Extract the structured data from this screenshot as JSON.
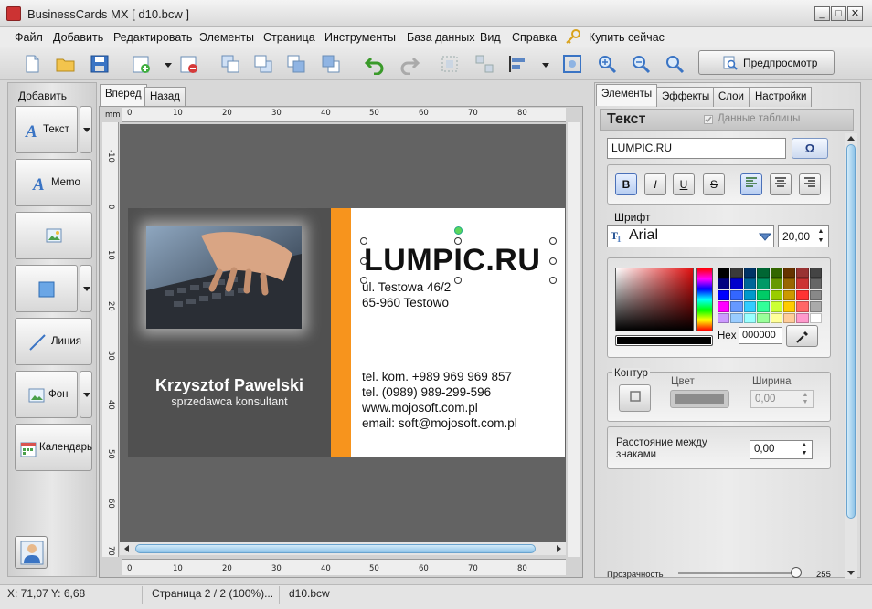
{
  "window": {
    "title": "BusinessCards MX [ d10.bcw ]",
    "min": "_",
    "max": "□",
    "close": "✕"
  },
  "menu": [
    "Файл",
    "Добавить",
    "Редактировать",
    "Элементы",
    "Страница",
    "Инструменты",
    "База данных",
    "Вид",
    "Справка",
    "Купить сейчас"
  ],
  "toolbar": {
    "preview_label": "Предпросмотр"
  },
  "left_panel": {
    "title": "Добавить",
    "buttons": [
      "Текст",
      "Memo",
      "",
      "",
      "Линия",
      "Фон",
      "Календарь"
    ]
  },
  "canvas_tabs": [
    "Вперед",
    "Назад"
  ],
  "ruler": {
    "unit": "mm",
    "h_labels": [
      "0",
      "10",
      "20",
      "30",
      "40",
      "50",
      "60",
      "70",
      "80"
    ],
    "v_labels": [
      "-10",
      "0",
      "10",
      "20",
      "30",
      "40",
      "50",
      "60",
      "70"
    ]
  },
  "card": {
    "name": "Krzysztof Pawelski",
    "role": "sprzedawca konsultant",
    "brand": "LUMPIC.RU",
    "address": [
      "ul. Testowa 46/2",
      "65-960 Testowo"
    ],
    "contacts": [
      "tel. kom. +989 969 969 857",
      "tel. (0989) 989-299-596",
      "www.mojosoft.com.pl",
      "email: soft@mojosoft.com.pl"
    ],
    "colors": {
      "left": "#505050",
      "stripe": "#f7941d",
      "right": "#ffffff"
    }
  },
  "right_panel": {
    "tabs": [
      "Элементы",
      "Эффекты",
      "Слои",
      "Настройки"
    ],
    "title": "Текст",
    "table_data_label": "Данные таблицы",
    "text_value": "LUMPIC.RU",
    "omega": "Ω",
    "format_buttons": [
      "B",
      "I",
      "U",
      "S"
    ],
    "font_label": "Шрифт",
    "font_name": "Arial",
    "font_size": "20,00",
    "hex_label": "Hex",
    "hex_value": "000000",
    "contour_label": "Контур",
    "color_label": "Цвет",
    "width_label": "Ширина",
    "width_value": "0,00",
    "spacing_label": "Расстояние между знаками",
    "spacing_value": "0,00",
    "opacity_label": "Прозрачность",
    "opacity_value": "255",
    "swatches": [
      "#000000",
      "#3a3a3a",
      "#003366",
      "#006633",
      "#336600",
      "#663300",
      "#993333",
      "#444444",
      "#000080",
      "#0000cc",
      "#006699",
      "#009966",
      "#669900",
      "#996600",
      "#cc3333",
      "#666666",
      "#0000ff",
      "#3366ff",
      "#0099cc",
      "#00cc66",
      "#99cc00",
      "#cc9900",
      "#ff3333",
      "#888888",
      "#ff00ff",
      "#6699ff",
      "#33ccff",
      "#33ff99",
      "#ccff33",
      "#ffcc00",
      "#ff6666",
      "#aaaaaa",
      "#cc99ff",
      "#99ccff",
      "#99ffff",
      "#99ff99",
      "#ffff99",
      "#ffcc99",
      "#ff99cc",
      "#ffffff"
    ]
  },
  "status": {
    "coords": "X: 71,07 Y: 6,68",
    "page": "Страница 2 / 2 (100%)...",
    "file": "d10.bcw"
  }
}
